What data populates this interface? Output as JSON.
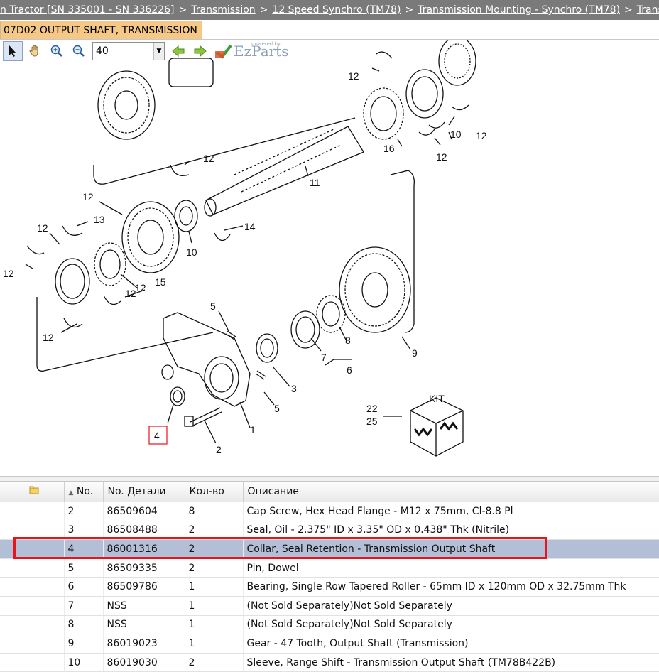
{
  "breadcrumb": {
    "items": [
      "n Tractor [SN 335001 - SN 336226]",
      "Transmission",
      "12 Speed Synchro (TM78)",
      "Transmission Mounting - Synchro (TM78)",
      "Transmi"
    ],
    "separator": ">"
  },
  "tab": {
    "label": "07D02 OUTPUT SHAFT, TRANSMISSION"
  },
  "toolbar": {
    "zoom_value": "40",
    "logo_powered": "powered by",
    "logo_name": "EzParts"
  },
  "diagram": {
    "callouts": [
      "12",
      "10",
      "12",
      "12",
      "16",
      "12",
      "11",
      "12",
      "13",
      "12",
      "10",
      "14",
      "12",
      "12",
      "15",
      "12",
      "12",
      "5",
      "9",
      "7",
      "8",
      "6",
      "3",
      "5",
      "1",
      "2",
      "4",
      "22",
      "25"
    ],
    "kit_label": "KIT"
  },
  "table": {
    "headers": {
      "icon": "folder-icon",
      "no": "No.",
      "part": "No. Детали",
      "qty": "Кол-во",
      "desc": "Описание"
    },
    "rows": [
      {
        "no": "2",
        "part": "86509604",
        "qty": "8",
        "desc": "Cap Screw, Hex Head Flange - M12 x 75mm, Cl-8.8 Pl"
      },
      {
        "no": "3",
        "part": "86508488",
        "qty": "2",
        "desc": "Seal, Oil - 2.375\" ID x 3.35\" OD x 0.438\" Thk (Nitrile)"
      },
      {
        "no": "4",
        "part": "86001316",
        "qty": "2",
        "desc": "Collar, Seal Retention - Transmission Output Shaft"
      },
      {
        "no": "5",
        "part": "86509335",
        "qty": "2",
        "desc": "Pin, Dowel"
      },
      {
        "no": "6",
        "part": "86509786",
        "qty": "1",
        "desc": "Bearing, Single Row Tapered Roller - 65mm ID x 120mm OD x 32.75mm Thk"
      },
      {
        "no": "7",
        "part": "NSS",
        "qty": "1",
        "desc": "(Not Sold Separately)Not Sold Separately"
      },
      {
        "no": "8",
        "part": "NSS",
        "qty": "1",
        "desc": "(Not Sold Separately)Not Sold Separately"
      },
      {
        "no": "9",
        "part": "86019023",
        "qty": "1",
        "desc": "Gear - 47 Tooth, Output Shaft (Transmission)"
      },
      {
        "no": "10",
        "part": "86019030",
        "qty": "2",
        "desc": "Sleeve, Range Shift - Transmission Output Shaft (TM78B422B)"
      }
    ],
    "selected_index": 2
  },
  "colors": {
    "selection": "#b3bfd6",
    "highlight_border": "#e5151b",
    "breadcrumb_bg": "#7a7a7a",
    "tab_bg": "#f5c887"
  }
}
